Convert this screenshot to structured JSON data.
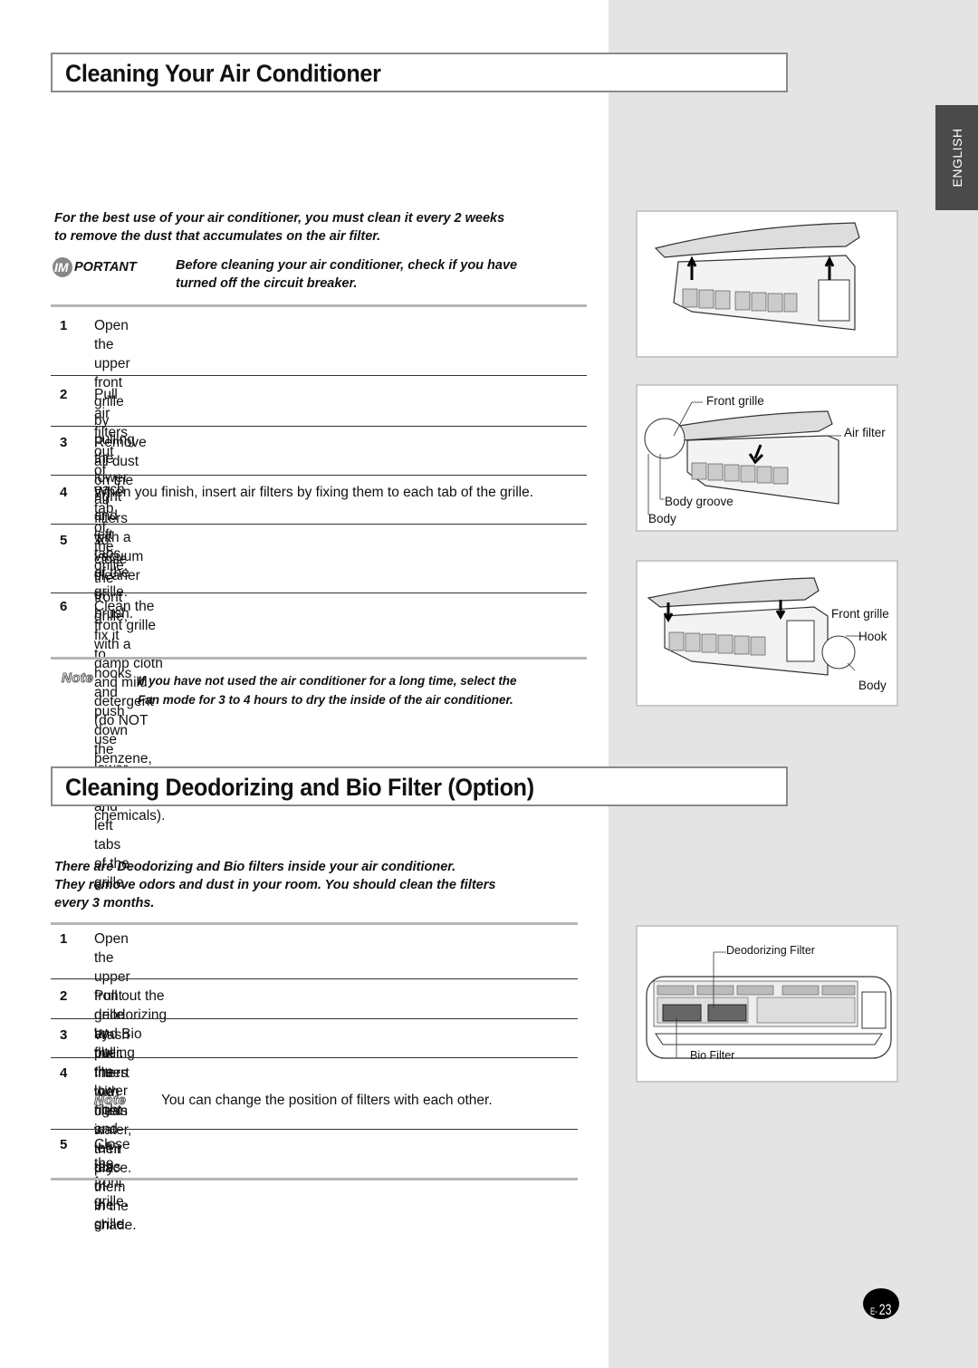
{
  "sidebar": {
    "language_tab": "ENGLISH"
  },
  "section1": {
    "title": "Cleaning Your Air Conditioner",
    "intro": [
      "For the best use of your air conditioner, you must clean it every 2 weeks",
      "to remove the dust that accumulates on the air filter."
    ],
    "important": {
      "badge_prefix": "IM",
      "badge_rest": "PORTANT",
      "text": [
        "Before cleaning your air conditioner, check if you have",
        "turned off the circuit breaker."
      ]
    },
    "steps": [
      {
        "num": "1",
        "lines": [
          "Open the upper front grille by pulling the lower right and left tabs",
          "of the grille."
        ]
      },
      {
        "num": "2",
        "lines": [
          "Pull air filters out of each tab of the grille."
        ]
      },
      {
        "num": "3",
        "lines": [
          "Remove all dust on the air filters with a vacuum cleaner or brush."
        ]
      },
      {
        "num": "4",
        "lines": [
          "When you finish, insert air filters by fixing them to each tab of the grille."
        ]
      },
      {
        "num": "5",
        "lines": [
          "To close the front grille, fix it to hooks and push down the lower",
          "right and left tabs of the grille."
        ]
      },
      {
        "num": "6",
        "lines": [
          "Clean the front grille with a damp cloth and mild detergent (do NOT",
          "use benzene, solvents or other chemicals)."
        ]
      }
    ],
    "note": {
      "label": "Note",
      "lines": [
        "If you have not used the air conditioner for a long time, select the",
        "Fan mode for 3 to 4 hours to dry the inside of the air conditioner."
      ]
    },
    "figures": {
      "fig2_labels": {
        "front_grille": "Front grille",
        "air_filter": "Air filter",
        "body_groove": "Body groove",
        "body": "Body"
      },
      "fig3_labels": {
        "front_grille": "Front grille",
        "hook": "Hook",
        "body": "Body"
      }
    }
  },
  "section2": {
    "title": "Cleaning Deodorizing and Bio Filter (Option)",
    "intro": [
      "There are Deodorizing and Bio filters inside your air conditioner.",
      "They remove odors and dust in your room. You should clean the filters",
      "every 3 months."
    ],
    "steps": [
      {
        "num": "1",
        "lines": [
          "Open the upper front grille by pulling the lower right and left tabs of",
          "the grille."
        ]
      },
      {
        "num": "2",
        "lines": [
          "Pull out the deodorizing and Bio filter."
        ]
      },
      {
        "num": "3",
        "lines": [
          "Wash the filters with clean water, then dry them in the shade."
        ]
      },
      {
        "num": "4",
        "lines": [
          "Insert the filters in their place."
        ]
      },
      {
        "num": "5",
        "lines": [
          "Close the front grille."
        ]
      }
    ],
    "step4_note": {
      "label": "Note",
      "text": "You can change the position of filters with each other."
    },
    "figure_labels": {
      "deodorizing_filter": "Deodorizing Filter",
      "bio_filter": "Bio Filter"
    }
  },
  "page": {
    "prefix": "E-",
    "number": "23"
  }
}
